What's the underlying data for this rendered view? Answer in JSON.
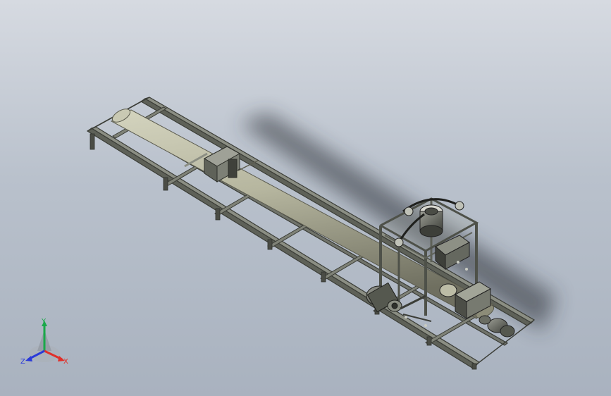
{
  "triad": {
    "y_label": "Y",
    "x_label": "X",
    "z_label": "Z",
    "colors": {
      "y": "#1aa84a",
      "x": "#e0302a",
      "z": "#2a3ad8"
    }
  },
  "colors": {
    "background_top": "#d6dae1",
    "background_bottom": "#a9b2bf",
    "steel": "#4e5149",
    "steel_light": "#8a8d82",
    "pipe": "#b7b7a0",
    "pipe_shadow": "#7d7d6c"
  }
}
